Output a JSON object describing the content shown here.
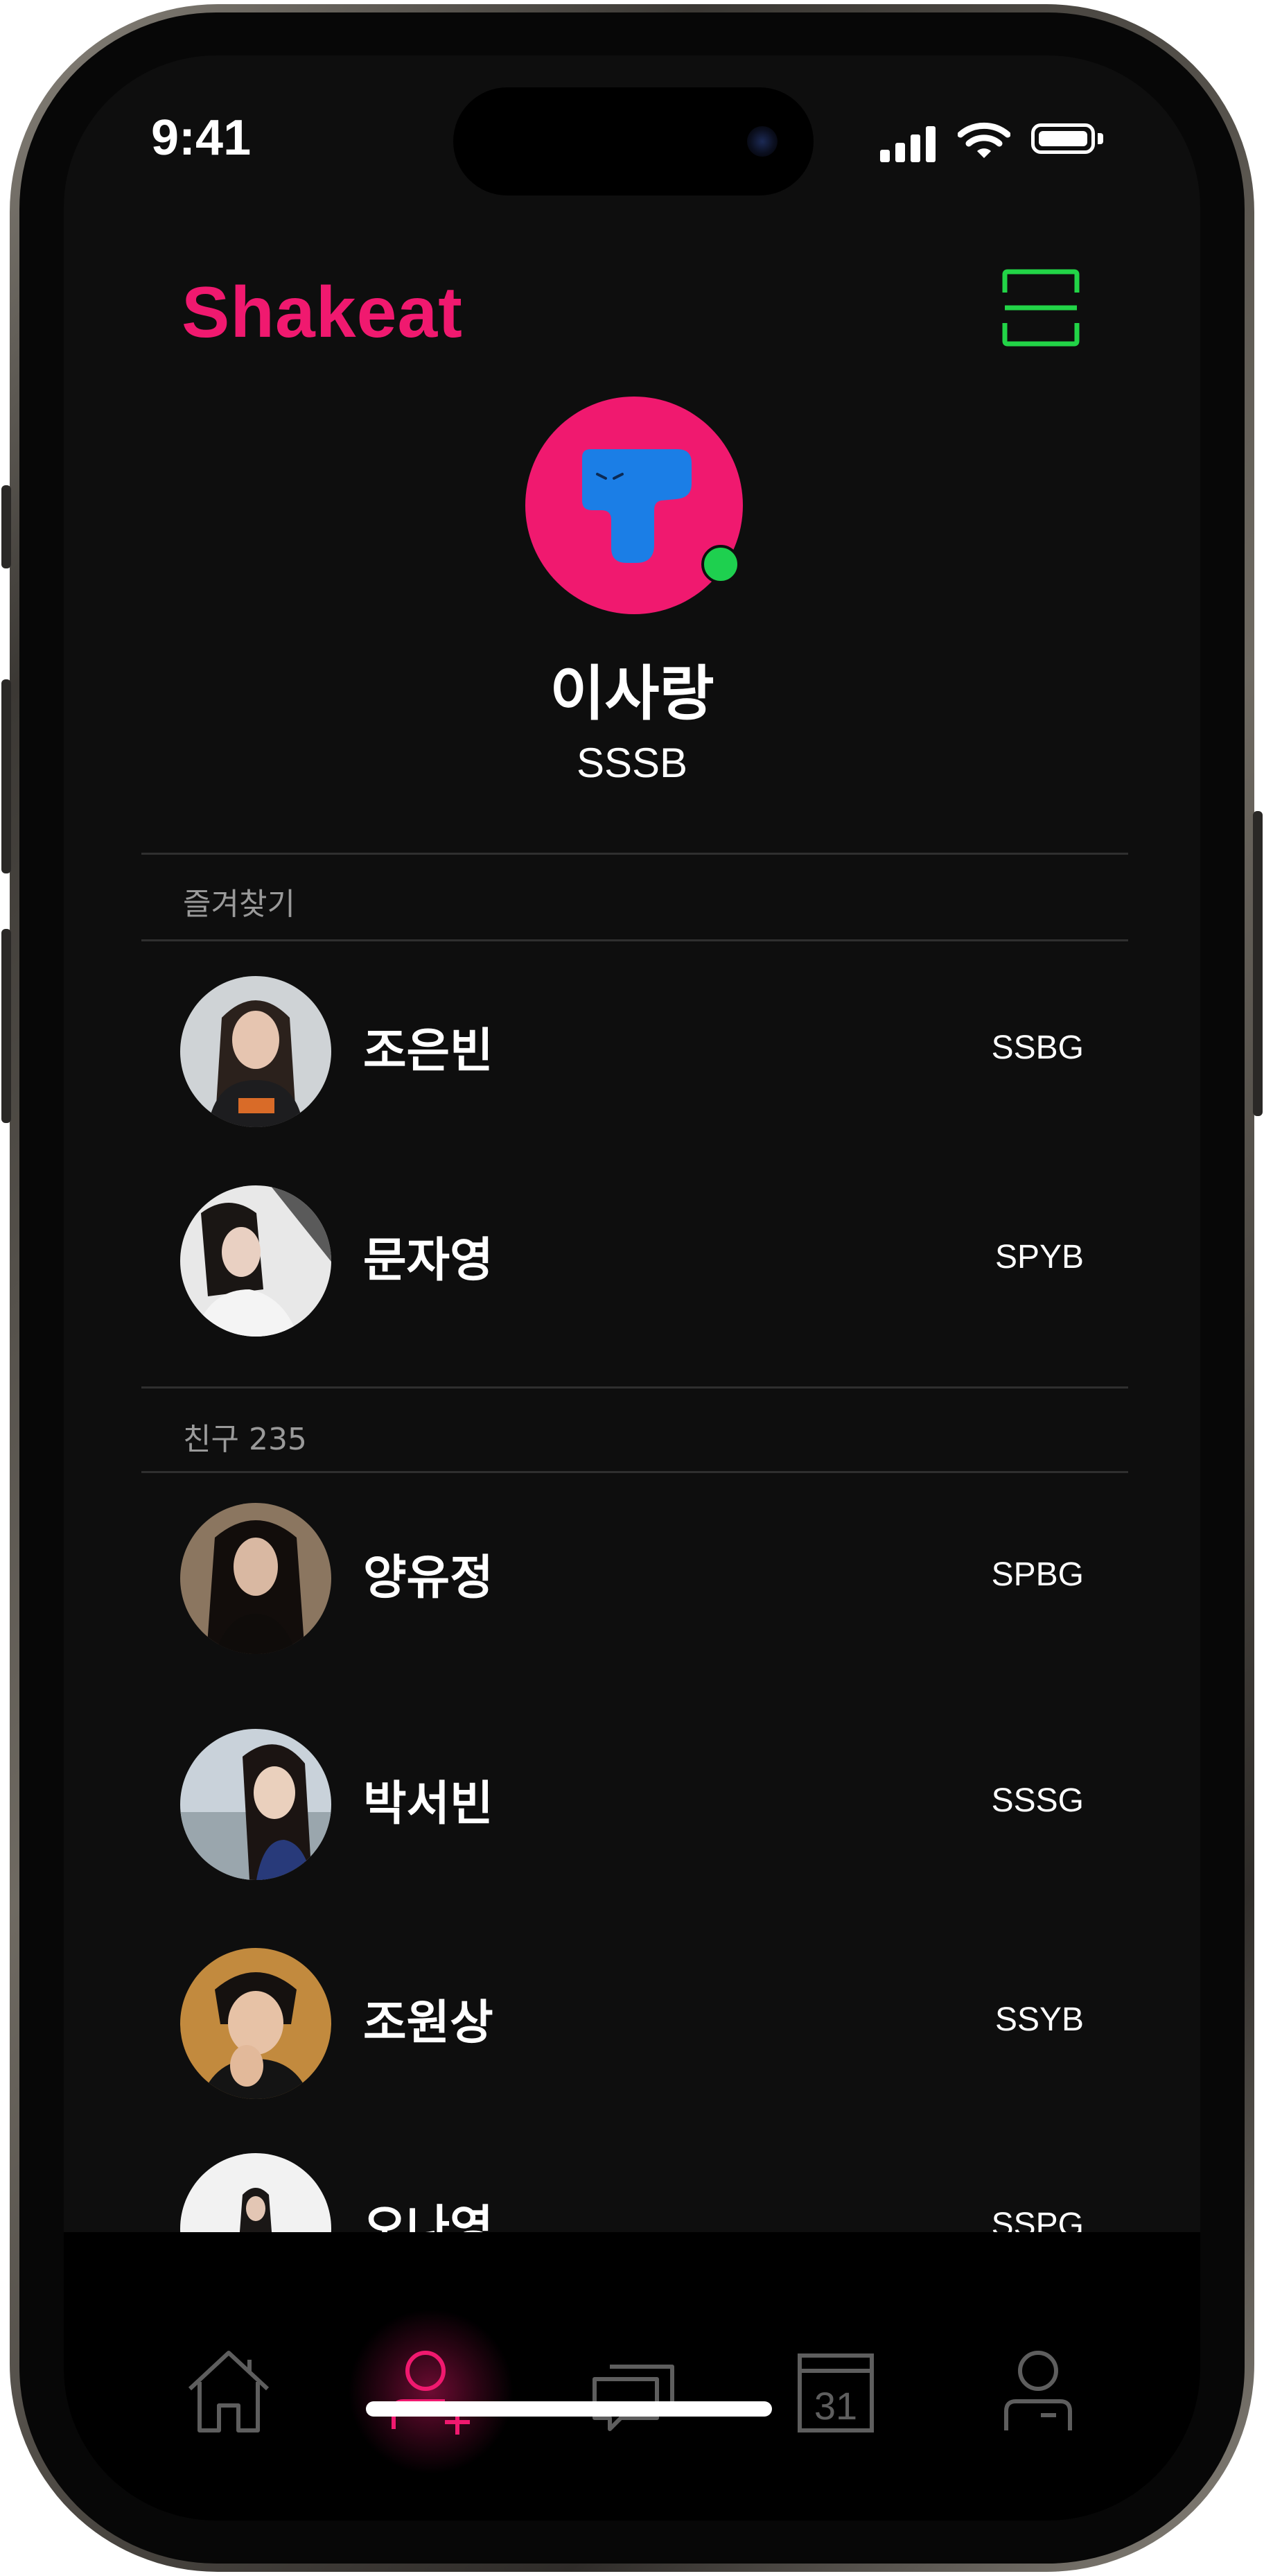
{
  "status_bar": {
    "time": "9:41"
  },
  "header": {
    "logo": "Shakeat",
    "scan_icon": "scan-frame-icon"
  },
  "colors": {
    "brand": "#f0196f",
    "online": "#1ed04f",
    "scan": "#22d447",
    "background": "#0e0e0e"
  },
  "profile": {
    "name": "이사랑",
    "code": "SSSB",
    "status": "online"
  },
  "favorites": {
    "label": "즐겨찾기",
    "items": [
      {
        "name": "조은빈",
        "code": "SSBG"
      },
      {
        "name": "문자영",
        "code": "SPYB"
      }
    ]
  },
  "friends": {
    "label": "친구 235",
    "items": [
      {
        "name": "양유정",
        "code": "SPBG"
      },
      {
        "name": "박서빈",
        "code": "SSSG"
      },
      {
        "name": "조원상",
        "code": "SSYB"
      },
      {
        "name": "오나영",
        "code": "SSPG"
      }
    ]
  },
  "tabbar": {
    "active": "friends",
    "tabs": [
      {
        "id": "home",
        "icon": "home-icon"
      },
      {
        "id": "friends",
        "icon": "add-friend-icon"
      },
      {
        "id": "chat",
        "icon": "chat-icon"
      },
      {
        "id": "calendar",
        "icon": "calendar-icon",
        "day": "31"
      },
      {
        "id": "profile",
        "icon": "profile-icon"
      }
    ]
  }
}
